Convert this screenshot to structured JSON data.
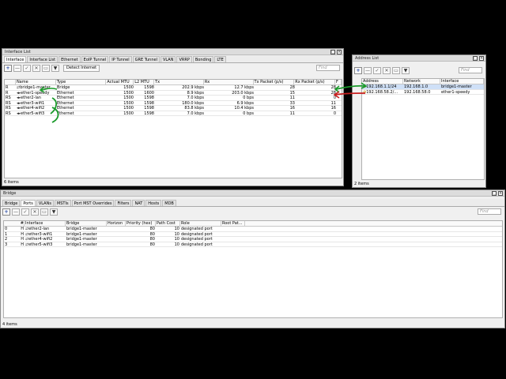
{
  "interface_list": {
    "title": "Interface List",
    "tabs": [
      "Interface",
      "Interface List",
      "Ethernet",
      "EoIP Tunnel",
      "IP Tunnel",
      "GRE Tunnel",
      "VLAN",
      "VRRP",
      "Bonding",
      "LTE"
    ],
    "detect_internet": "Detect Internet",
    "find_placeholder": "Find",
    "columns": [
      "",
      "Name",
      "Type",
      "Actual MTU",
      "L2 MTU",
      "Tx",
      "Rx",
      "Tx Packet (p/s)",
      "Rx Packet (p/s)",
      "F"
    ],
    "rows": [
      {
        "flag": "R",
        "icon": "⇄",
        "name": "bridge1-master",
        "type": "Bridge",
        "mtu": "1500",
        "l2mtu": "1598",
        "tx": "202.9 kbps",
        "rx": "12.7 kbps",
        "txp": "28",
        "rxp": "28"
      },
      {
        "flag": "R",
        "icon": "◂▸",
        "name": "ether1-speedy",
        "type": "Ethernet",
        "mtu": "1500",
        "l2mtu": "1600",
        "tx": "8.9 kbps",
        "rx": "203.0 kbps",
        "txp": "15",
        "rxp": "28"
      },
      {
        "flag": "RS",
        "icon": "◂▸",
        "name": "ether2-lan",
        "type": "Ethernet",
        "mtu": "1500",
        "l2mtu": "1598",
        "tx": "7.0 kbps",
        "rx": "0 bps",
        "txp": "11",
        "rxp": "0"
      },
      {
        "flag": "RS",
        "icon": "◂▸",
        "name": "ether3-wifi1",
        "type": "Ethernet",
        "mtu": "1500",
        "l2mtu": "1598",
        "tx": "180.0 kbps",
        "rx": "6.9 kbps",
        "txp": "33",
        "rxp": "11"
      },
      {
        "flag": "RS",
        "icon": "◂▸",
        "name": "ether4-wifi2",
        "type": "Ethernet",
        "mtu": "1500",
        "l2mtu": "1598",
        "tx": "83.8 kbps",
        "rx": "10.4 kbps",
        "txp": "16",
        "rxp": "16"
      },
      {
        "flag": "RS",
        "icon": "◂▸",
        "name": "ether5-wifi3",
        "type": "Ethernet",
        "mtu": "1500",
        "l2mtu": "1598",
        "tx": "7.0 kbps",
        "rx": "0 bps",
        "txp": "11",
        "rxp": "0"
      }
    ],
    "status": "6 items"
  },
  "address_list": {
    "title": "Address List",
    "find_placeholder": "Find",
    "columns": [
      "Address",
      "Network",
      "Interface"
    ],
    "rows": [
      {
        "icon": "⊕",
        "address": "192.168.1.1/24",
        "network": "192.168.1.0",
        "interface": "bridge1-master"
      },
      {
        "icon": "⊕",
        "address": "192.168.58.2/...",
        "network": "192.168.58.0",
        "interface": "ether1-speedy"
      }
    ],
    "status": "2 items"
  },
  "bridge": {
    "title": "Bridge",
    "tabs": [
      "Bridge",
      "Ports",
      "VLANs",
      "MSTIs",
      "Port MST Overrides",
      "Filters",
      "NAT",
      "Hosts",
      "MDB"
    ],
    "find_placeholder": "Find",
    "columns": [
      "#",
      "Interface",
      "Bridge",
      "Horizon",
      "Priority (hex)",
      "Path Cost",
      "Role",
      "Root Pat..."
    ],
    "rows": [
      {
        "num": "0",
        "flag": "H",
        "icon": "⇄",
        "interface": "ether2-lan",
        "bridge": "bridge1-master",
        "horizon": "",
        "priority": "80",
        "cost": "10",
        "role": "designated port",
        "root": ""
      },
      {
        "num": "1",
        "flag": "H",
        "icon": "⇄",
        "interface": "ether3-wifi1",
        "bridge": "bridge1-master",
        "horizon": "",
        "priority": "80",
        "cost": "10",
        "role": "designated port",
        "root": ""
      },
      {
        "num": "2",
        "flag": "H",
        "icon": "⇄",
        "interface": "ether4-wifi2",
        "bridge": "bridge1-master",
        "horizon": "",
        "priority": "80",
        "cost": "10",
        "role": "designated port",
        "root": ""
      },
      {
        "num": "3",
        "flag": "H",
        "icon": "⇄",
        "interface": "ether5-wifi3",
        "bridge": "bridge1-master",
        "horizon": "",
        "priority": "80",
        "cost": "10",
        "role": "designated port",
        "root": ""
      }
    ],
    "status": "4 items"
  },
  "colors": {
    "annotation_green": "#1a9a2a",
    "annotation_red": "#c81e1e",
    "selected_row": "#cfe0f7"
  }
}
